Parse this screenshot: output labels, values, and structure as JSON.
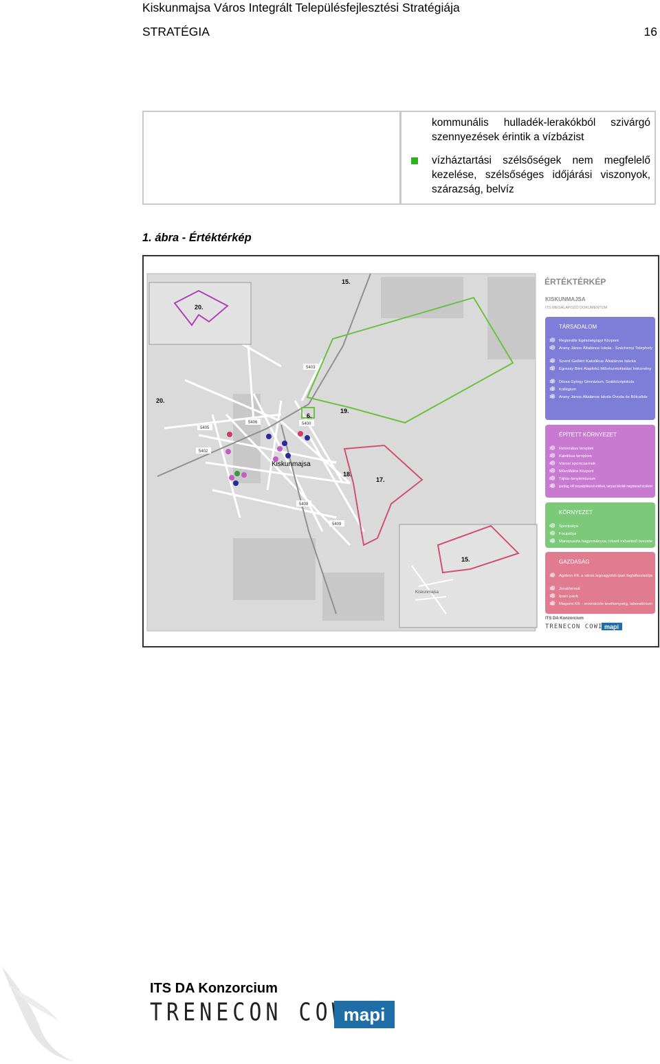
{
  "header": {
    "title": "Kiskunmajsa Város Integrált Településfejlesztési Stratégiája",
    "section": "STRATÉGIA",
    "page_number": "16"
  },
  "table": {
    "paragraph_1": "kommunális hulladék-lerakókból szivárgó szennyezések érintik a vízbázist",
    "paragraph_2": "vízháztartási szélsőségek nem megfelelő kezelése, szélsőséges időjárási viszonyok, szárazság, belvíz",
    "bullet_color": "#2db11d"
  },
  "figure": {
    "caption": "1. ábra - Értéktérkép",
    "map": {
      "title": "ÉRTÉKTÉRKÉP",
      "subtitle": "KISKUNMAJSA",
      "subtitle2": "ITS MEGALAPOZÓ DOKUMENTUM",
      "town_label": "Kiskunmajsa",
      "town_label_small": "Kiskunmajsa",
      "area_labels": [
        "15.",
        "15.",
        "17.",
        "18.",
        "19.",
        "20.",
        "20.",
        "6."
      ],
      "road_labels": [
        "5402",
        "5403",
        "5405",
        "5406",
        "5408",
        "5409",
        "5400"
      ],
      "legend": [
        {
          "heading": "TÁRSADALOM",
          "color": "#7e7ed9",
          "items": [
            {
              "num": "1",
              "text": "Regionális Egészségügyi Központ"
            },
            {
              "num": "9",
              "text": "Arany János Általános Iskola - Széchenyi Telephely"
            },
            {
              "num": "10",
              "text": "Szent Gellért Katolikus Általános Iskola"
            },
            {
              "num": "11",
              "text": "Egressy Béni Alapfokú Művészetoktatási Intézmény"
            },
            {
              "num": "12",
              "text": "Dózsa György Gimnázium, Szakközépiskola"
            },
            {
              "num": "13",
              "text": "Kollégium"
            },
            {
              "num": "14",
              "text": "Arany János Általános Iskola Óvoda és Bölcsőde"
            }
          ]
        },
        {
          "heading": "ÉPÍTETT KÖRNYEZET",
          "color": "#c77ad0",
          "items": [
            {
              "num": "2",
              "text": "Református templom"
            },
            {
              "num": "3",
              "text": "Katolikus templom"
            },
            {
              "num": "4",
              "text": "Városi sportcsarnok"
            },
            {
              "num": "5",
              "text": "Művelődési Központ"
            },
            {
              "num": "8",
              "text": "Tájház-kenyérmúzeum"
            },
            {
              "num": "20.",
              "text": "gazdag, élő tanyaépítészeti értékek, tanyasi iskolák megmaradt épületei"
            }
          ]
        },
        {
          "heading": "KÖRNYEZET",
          "color": "#7dc97a",
          "items": [
            {
              "num": "6.",
              "text": "Sportpálya"
            },
            {
              "num": "7",
              "text": "Focipálya"
            },
            {
              "num": "19.",
              "text": "Marispuszta hagyományos, lokarit művelésű övezete"
            }
          ]
        },
        {
          "heading": "GAZDASÁG",
          "color": "#e07b90",
          "items": [
            {
              "num": "16",
              "text": "Agrikon Kft. a város legnagyobb ipari foglalkoztatója"
            },
            {
              "num": "15.",
              "text": "Jonathermál"
            },
            {
              "num": "17.",
              "text": "Ipari park"
            },
            {
              "num": "18.",
              "text": "Magumi Kft. - innovációs tevékenység, laboratórium"
            }
          ]
        }
      ],
      "credit": "ITS DA Konzorcium",
      "credit_logos": "TRENECON COWI",
      "credit_mapi": "mapi"
    }
  },
  "footer": {
    "org": "ITS DA Konzorcium",
    "logo_text": "TRENECON COWI",
    "mapi": "mapi"
  }
}
